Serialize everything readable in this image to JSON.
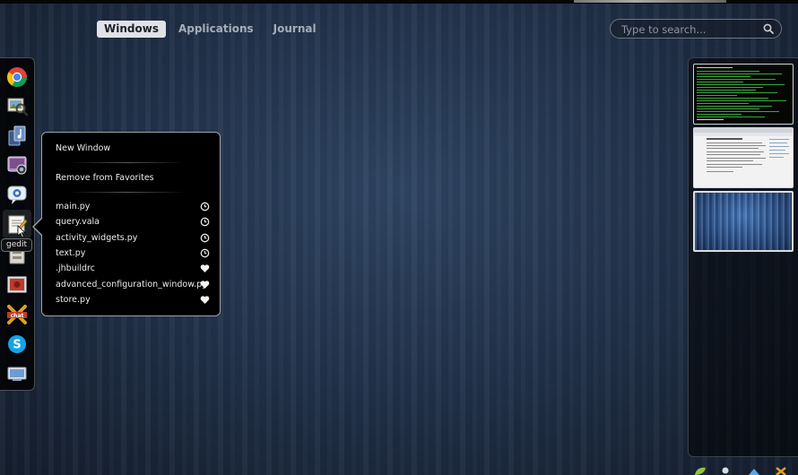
{
  "view_tabs": {
    "windows": "Windows",
    "applications": "Applications",
    "journal": "Journal",
    "active": "windows"
  },
  "search": {
    "placeholder": "Type to search...",
    "value": ""
  },
  "dash": {
    "items": [
      {
        "name": "chrome",
        "icon": "chrome-icon"
      },
      {
        "name": "image-viewer",
        "icon": "magnifier-photo-icon"
      },
      {
        "name": "music-player",
        "icon": "music-icon"
      },
      {
        "name": "screenshot",
        "icon": "camera-icon"
      },
      {
        "name": "empathy",
        "icon": "chat-icon"
      },
      {
        "name": "gedit",
        "icon": "gedit-icon"
      },
      {
        "name": "archive",
        "icon": "archive-icon"
      },
      {
        "name": "presentation",
        "icon": "presentation-icon"
      },
      {
        "name": "xchat",
        "icon": "xchat-icon"
      },
      {
        "name": "skype",
        "icon": "skype-icon"
      },
      {
        "name": "remote-desktop",
        "icon": "remote-desktop-icon"
      }
    ],
    "tooltip": "gedit",
    "hovered": "gedit"
  },
  "app_menu": {
    "new_window": "New Window",
    "remove_from_favorites": "Remove from Favorites",
    "documents": [
      {
        "label": "main.py",
        "icon": "recent-icon"
      },
      {
        "label": "query.vala",
        "icon": "recent-icon"
      },
      {
        "label": "activity_widgets.py",
        "icon": "recent-icon"
      },
      {
        "label": "text.py",
        "icon": "recent-icon"
      },
      {
        "label": ".jhbuildrc",
        "icon": "favorite-heart-icon"
      },
      {
        "label": "advanced_configuration_window.py",
        "icon": "favorite-heart-icon"
      },
      {
        "label": "store.py",
        "icon": "favorite-heart-icon"
      }
    ]
  },
  "workspaces": [
    {
      "name": "terminal",
      "active": false
    },
    {
      "name": "browser",
      "active": false
    },
    {
      "name": "empty",
      "active": true
    }
  ],
  "colors": {
    "accent_terminal": "#3aa63a",
    "menu_bg": "#000000",
    "active_tab_bg": "#dfe2e6"
  }
}
